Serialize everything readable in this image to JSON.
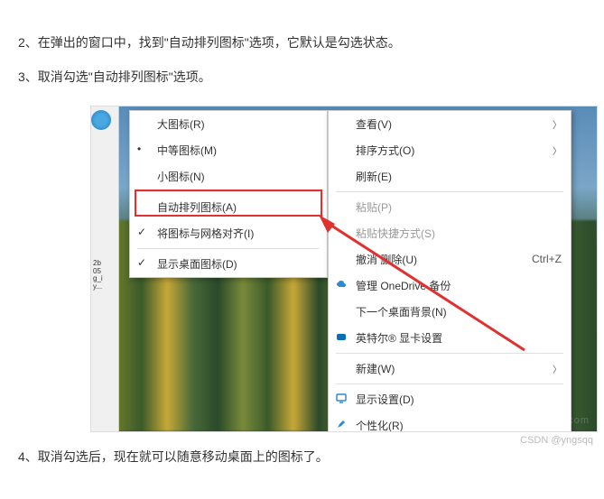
{
  "steps": {
    "s2": "2、在弹出的窗口中，找到\"自动排列图标\"选项，它默认是勾选状态。",
    "s3": "3、取消勾选\"自动排列图标\"选项。",
    "s4": "4、取消勾选后，现在就可以随意移动桌面上的图标了。"
  },
  "left_menu": {
    "large_icons": "大图标(R)",
    "medium_icons": "中等图标(M)",
    "small_icons": "小图标(N)",
    "auto_arrange": "自动排列图标(A)",
    "align_grid": "将图标与网格对齐(I)",
    "show_desktop_icons": "显示桌面图标(D)"
  },
  "right_menu": {
    "view": "查看(V)",
    "sort": "排序方式(O)",
    "refresh": "刷新(E)",
    "paste": "粘贴(P)",
    "paste_shortcut": "粘贴快捷方式(S)",
    "undo_delete": "撤消 删除(U)",
    "undo_shortcut": "Ctrl+Z",
    "onedrive": "管理 OneDrive 备份",
    "next_bg": "下一个桌面背景(N)",
    "intel": "英特尔® 显卡设置",
    "new": "新建(W)",
    "display": "显示设置(D)",
    "personalize": "个性化(R)"
  },
  "thumb_labels": {
    "l1": "2b",
    "l2": "05",
    "l3": "g_i",
    "l4": "y..."
  },
  "watermark": "www.xitongcheng.com",
  "credit": "CSDN @yngsqq"
}
